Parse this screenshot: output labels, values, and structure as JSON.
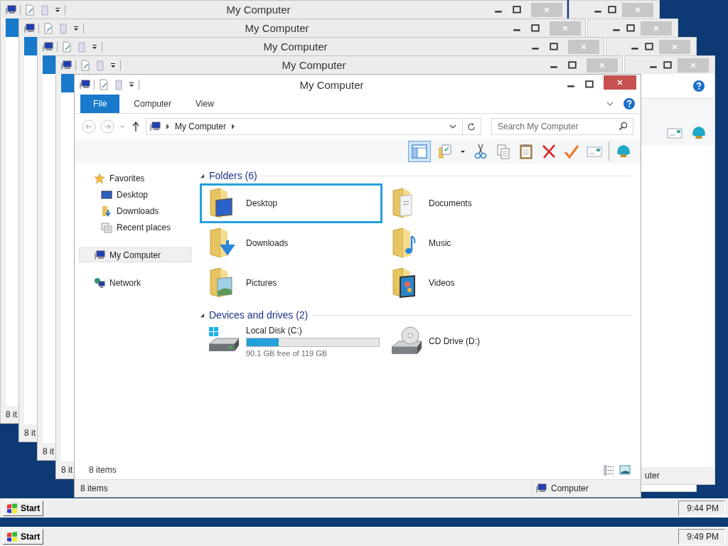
{
  "back_windows": [
    {
      "title": "My Computer",
      "status": "8 it"
    },
    {
      "title": "My Computer",
      "status": "8 it"
    },
    {
      "title": "My Computer",
      "status": "8 it"
    },
    {
      "title": "My Computer",
      "status": "8 it"
    }
  ],
  "side_window": {
    "status": "uter"
  },
  "window": {
    "title": "My Computer",
    "tabs": [
      {
        "label": "File",
        "selected": true
      },
      {
        "label": "Computer",
        "selected": false
      },
      {
        "label": "View",
        "selected": false
      }
    ],
    "address": {
      "crumbs": [
        "My Computer"
      ]
    },
    "search": {
      "placeholder": "Search My Computer"
    },
    "preview_pane_on": true,
    "nav": [
      {
        "label": "Favorites",
        "kind": "star",
        "selected": false,
        "children": [
          {
            "label": "Desktop",
            "kind": "desktop",
            "selected": false
          },
          {
            "label": "Downloads",
            "kind": "downloads",
            "selected": false
          },
          {
            "label": "Recent places",
            "kind": "recent",
            "selected": false
          }
        ]
      },
      {
        "label": "My Computer",
        "kind": "computer",
        "selected": true
      },
      {
        "label": "Network",
        "kind": "network",
        "selected": false
      }
    ],
    "sections": [
      {
        "title": "Folders (6)",
        "kind": "folders",
        "items": [
          {
            "name": "Desktop",
            "kind": "desktop",
            "selected": true
          },
          {
            "name": "Documents",
            "kind": "documents",
            "selected": false
          },
          {
            "name": "Downloads",
            "kind": "downloads",
            "selected": false
          },
          {
            "name": "Music",
            "kind": "music",
            "selected": false
          },
          {
            "name": "Pictures",
            "kind": "pictures",
            "selected": false
          },
          {
            "name": "Videos",
            "kind": "videos",
            "selected": false
          }
        ]
      },
      {
        "title": "Devices and drives (2)",
        "kind": "drives",
        "items": [
          {
            "name": "Local Disk (C:)",
            "kind": "hdd",
            "level": 0.24,
            "detail": "90.1 GB free of 119 GB"
          },
          {
            "name": "CD Drive (D:)",
            "kind": "cd"
          }
        ]
      }
    ],
    "item_count": "8 items",
    "status_bar": {
      "count": "8 items",
      "location": "Computer"
    }
  },
  "taskbars": [
    {
      "start": "Start",
      "clock": "9:44 PM"
    },
    {
      "start": "Start",
      "clock": "9:49 PM"
    }
  ]
}
